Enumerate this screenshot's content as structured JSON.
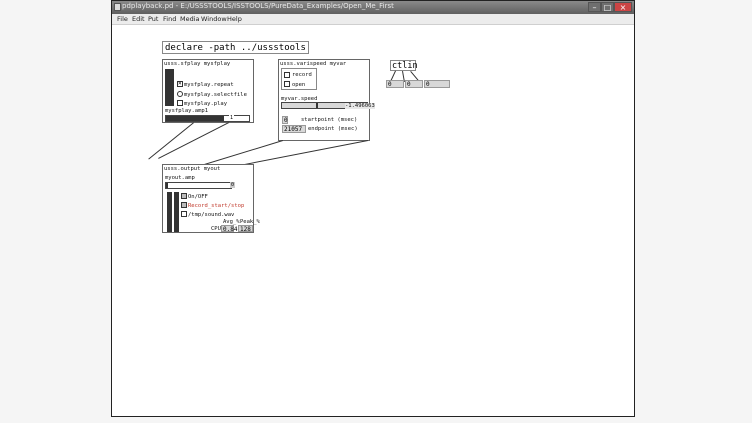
{
  "window": {
    "title": "pdplayback.pd - E:/USSSTOOLS/ISSTOOLS/PureData_Examples/Open_Me_First"
  },
  "menu": [
    "File",
    "Edit",
    "Put",
    "Find",
    "Media",
    "Window",
    "Help"
  ],
  "declare": "declare -path ../ussstools",
  "sfplay": {
    "header": "usss.sfplay mysfplay",
    "repeat": "mysfplay.repeat",
    "selectfile": "mysfplay.selectfile",
    "play": "mysfplay.play",
    "amp_label": "mysfplay.amp1",
    "amp_value": "1"
  },
  "varispeed": {
    "header": "usss.varispeed myvar",
    "record": "record",
    "open": "open",
    "speed_label": "myvar.speed",
    "speed_value": "-1.496063",
    "startpoint_value": "0",
    "startpoint_label": "startpoint (msec)",
    "endpoint_value": "21057",
    "endpoint_label": "endpoint (msec)"
  },
  "ctlin": {
    "label": "ctlin",
    "outlets": [
      "0",
      "0",
      "0"
    ]
  },
  "output": {
    "header": "usss.output myout",
    "amp_label": "myout.amp",
    "amp_value": "0",
    "onoff": "On/OFF",
    "record": "Record_start/stop",
    "path": "/tmp/sound.wav",
    "avg_label": "Avg_%",
    "peak_label": "Peak_%",
    "cpu_label": "CPU",
    "avg_value": "0.84",
    "peak_value": "128",
    "record_color": "#c0392b"
  }
}
